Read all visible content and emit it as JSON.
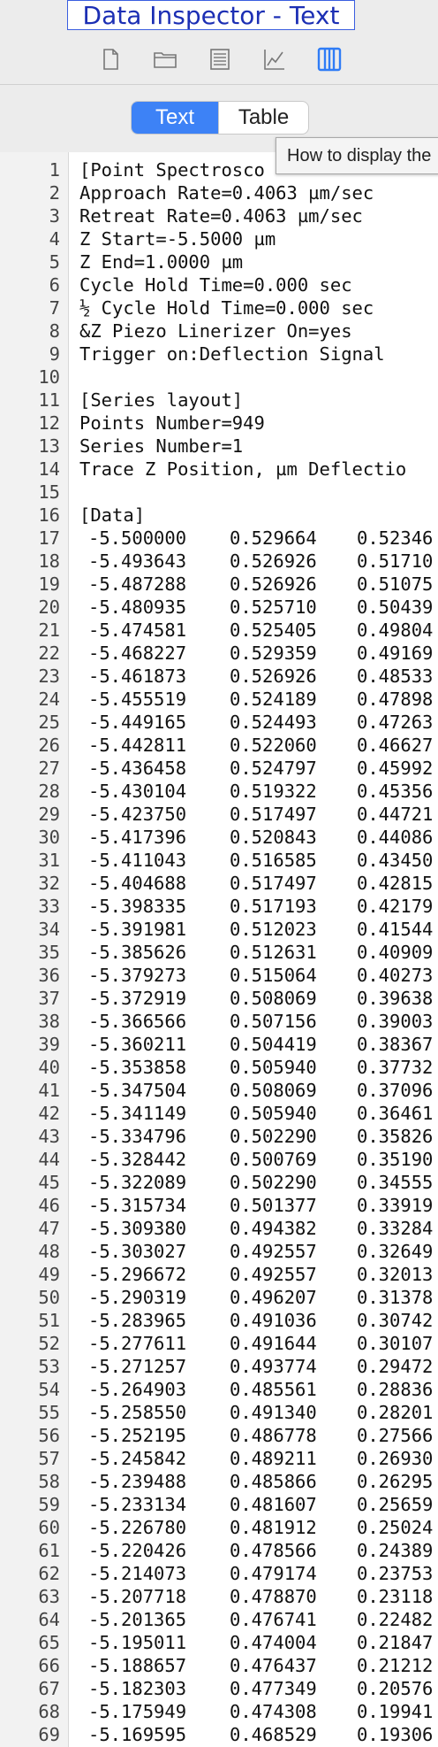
{
  "window": {
    "title": "Data Inspector - Text"
  },
  "toolbar": {
    "icons": [
      "document-icon",
      "folder-icon",
      "list-icon",
      "chart-icon",
      "columns-icon"
    ],
    "active_icon": "columns-icon"
  },
  "view_toggle": {
    "options": [
      "Text",
      "Table"
    ],
    "selected": "Text"
  },
  "tooltip": {
    "text": "How to display the"
  },
  "header_lines": [
    "[Point Spectrosco",
    "Approach Rate=0.4063 µm/sec",
    "Retreat Rate=0.4063 µm/sec",
    "Z Start=-5.5000 µm",
    "Z End=1.0000 µm",
    "Cycle Hold Time=0.000 sec",
    "½ Cycle Hold Time=0.000 sec",
    "&Z Piezo Linerizer On=yes",
    "Trigger on:Deflection Signal",
    "",
    "[Series layout]",
    "Points Number=949",
    "Series Number=1",
    "Trace Z Position, µm Deflectio",
    "",
    "[Data]"
  ],
  "data_rows": [
    [
      "-5.500000",
      "0.529664",
      "0.52346"
    ],
    [
      "-5.493643",
      "0.526926",
      "0.51710"
    ],
    [
      "-5.487288",
      "0.526926",
      "0.51075"
    ],
    [
      "-5.480935",
      "0.525710",
      "0.50439"
    ],
    [
      "-5.474581",
      "0.525405",
      "0.49804"
    ],
    [
      "-5.468227",
      "0.529359",
      "0.49169"
    ],
    [
      "-5.461873",
      "0.526926",
      "0.48533"
    ],
    [
      "-5.455519",
      "0.524189",
      "0.47898"
    ],
    [
      "-5.449165",
      "0.524493",
      "0.47263"
    ],
    [
      "-5.442811",
      "0.522060",
      "0.46627"
    ],
    [
      "-5.436458",
      "0.524797",
      "0.45992"
    ],
    [
      "-5.430104",
      "0.519322",
      "0.45356"
    ],
    [
      "-5.423750",
      "0.517497",
      "0.44721"
    ],
    [
      "-5.417396",
      "0.520843",
      "0.44086"
    ],
    [
      "-5.411043",
      "0.516585",
      "0.43450"
    ],
    [
      "-5.404688",
      "0.517497",
      "0.42815"
    ],
    [
      "-5.398335",
      "0.517193",
      "0.42179"
    ],
    [
      "-5.391981",
      "0.512023",
      "0.41544"
    ],
    [
      "-5.385626",
      "0.512631",
      "0.40909"
    ],
    [
      "-5.379273",
      "0.515064",
      "0.40273"
    ],
    [
      "-5.372919",
      "0.508069",
      "0.39638"
    ],
    [
      "-5.366566",
      "0.507156",
      "0.39003"
    ],
    [
      "-5.360211",
      "0.504419",
      "0.38367"
    ],
    [
      "-5.353858",
      "0.505940",
      "0.37732"
    ],
    [
      "-5.347504",
      "0.508069",
      "0.37096"
    ],
    [
      "-5.341149",
      "0.505940",
      "0.36461"
    ],
    [
      "-5.334796",
      "0.502290",
      "0.35826"
    ],
    [
      "-5.328442",
      "0.500769",
      "0.35190"
    ],
    [
      "-5.322089",
      "0.502290",
      "0.34555"
    ],
    [
      "-5.315734",
      "0.501377",
      "0.33919"
    ],
    [
      "-5.309380",
      "0.494382",
      "0.33284"
    ],
    [
      "-5.303027",
      "0.492557",
      "0.32649"
    ],
    [
      "-5.296672",
      "0.492557",
      "0.32013"
    ],
    [
      "-5.290319",
      "0.496207",
      "0.31378"
    ],
    [
      "-5.283965",
      "0.491036",
      "0.30742"
    ],
    [
      "-5.277611",
      "0.491644",
      "0.30107"
    ],
    [
      "-5.271257",
      "0.493774",
      "0.29472"
    ],
    [
      "-5.264903",
      "0.485561",
      "0.28836"
    ],
    [
      "-5.258550",
      "0.491340",
      "0.28201"
    ],
    [
      "-5.252195",
      "0.486778",
      "0.27566"
    ],
    [
      "-5.245842",
      "0.489211",
      "0.26930"
    ],
    [
      "-5.239488",
      "0.485866",
      "0.26295"
    ],
    [
      "-5.233134",
      "0.481607",
      "0.25659"
    ],
    [
      "-5.226780",
      "0.481912",
      "0.25024"
    ],
    [
      "-5.220426",
      "0.478566",
      "0.24389"
    ],
    [
      "-5.214073",
      "0.479174",
      "0.23753"
    ],
    [
      "-5.207718",
      "0.478870",
      "0.23118"
    ],
    [
      "-5.201365",
      "0.476741",
      "0.22482"
    ],
    [
      "-5.195011",
      "0.474004",
      "0.21847"
    ],
    [
      "-5.188657",
      "0.476437",
      "0.21212"
    ],
    [
      "-5.182303",
      "0.477349",
      "0.20576"
    ],
    [
      "-5.175949",
      "0.474308",
      "0.19941"
    ],
    [
      "-5.169595",
      "0.468529",
      "0.19306"
    ]
  ]
}
